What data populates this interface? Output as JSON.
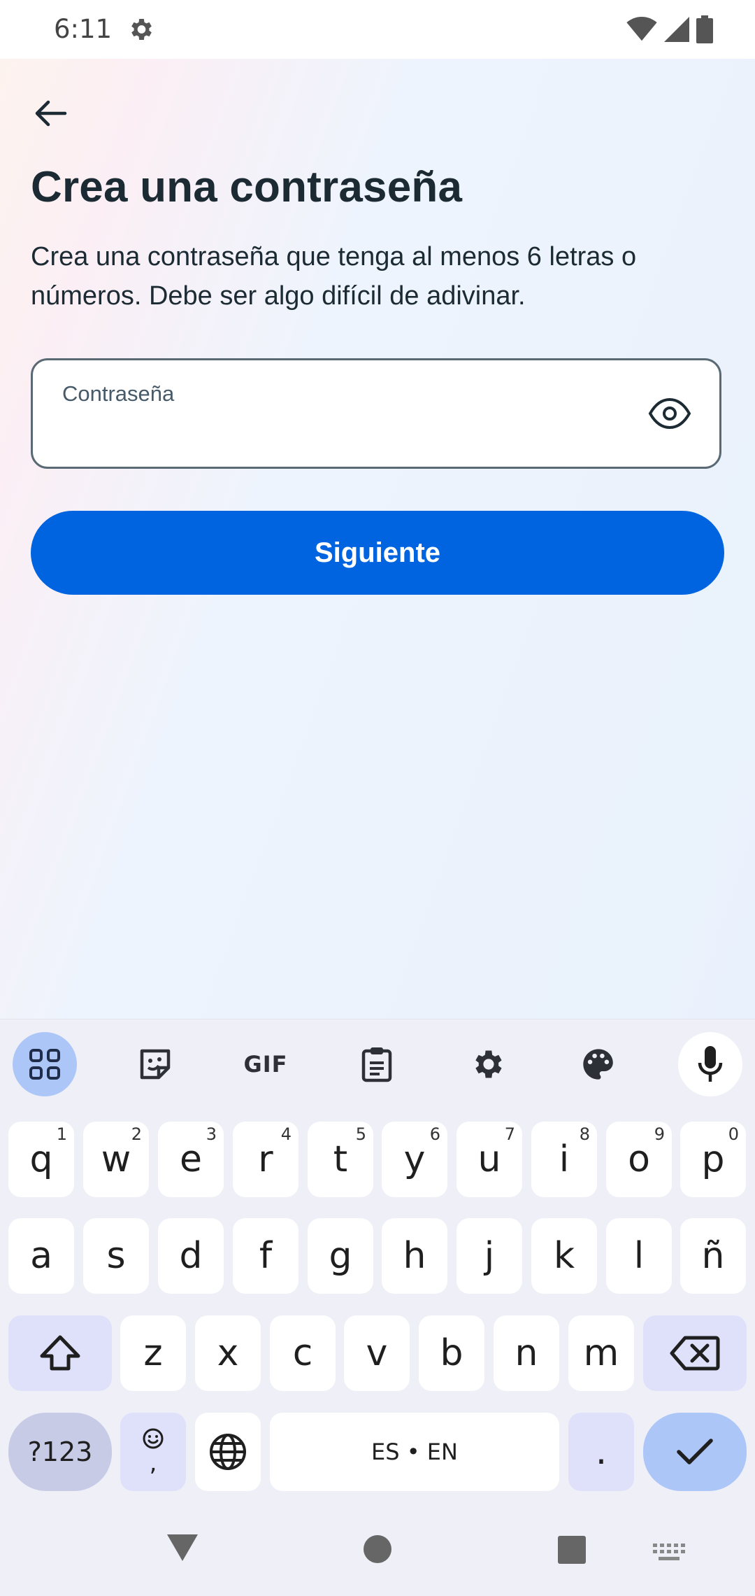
{
  "status": {
    "time": "6:11"
  },
  "page": {
    "title": "Crea una contraseña",
    "subtitle": "Crea una contraseña que tenga al menos 6 letras o números. Debe ser algo difícil de adivinar."
  },
  "password_field": {
    "label": "Contraseña",
    "value": ""
  },
  "next_button": {
    "label": "Siguiente"
  },
  "colors": {
    "primary": "#0064e0",
    "text": "#1c2b33",
    "keyboard_bg": "#eff0f7",
    "accent_key": "#adc6f8"
  },
  "keyboard": {
    "toolbar": {
      "gif_label": "GIF"
    },
    "row1": [
      {
        "key": "q",
        "hint": "1"
      },
      {
        "key": "w",
        "hint": "2"
      },
      {
        "key": "e",
        "hint": "3"
      },
      {
        "key": "r",
        "hint": "4"
      },
      {
        "key": "t",
        "hint": "5"
      },
      {
        "key": "y",
        "hint": "6"
      },
      {
        "key": "u",
        "hint": "7"
      },
      {
        "key": "i",
        "hint": "8"
      },
      {
        "key": "o",
        "hint": "9"
      },
      {
        "key": "p",
        "hint": "0"
      }
    ],
    "row2": [
      "a",
      "s",
      "d",
      "f",
      "g",
      "h",
      "j",
      "k",
      "l",
      "ñ"
    ],
    "row3": [
      "z",
      "x",
      "c",
      "v",
      "b",
      "n",
      "m"
    ],
    "sym_label": "?123",
    "comma": ",",
    "space_label": "ES • EN",
    "period": "."
  }
}
